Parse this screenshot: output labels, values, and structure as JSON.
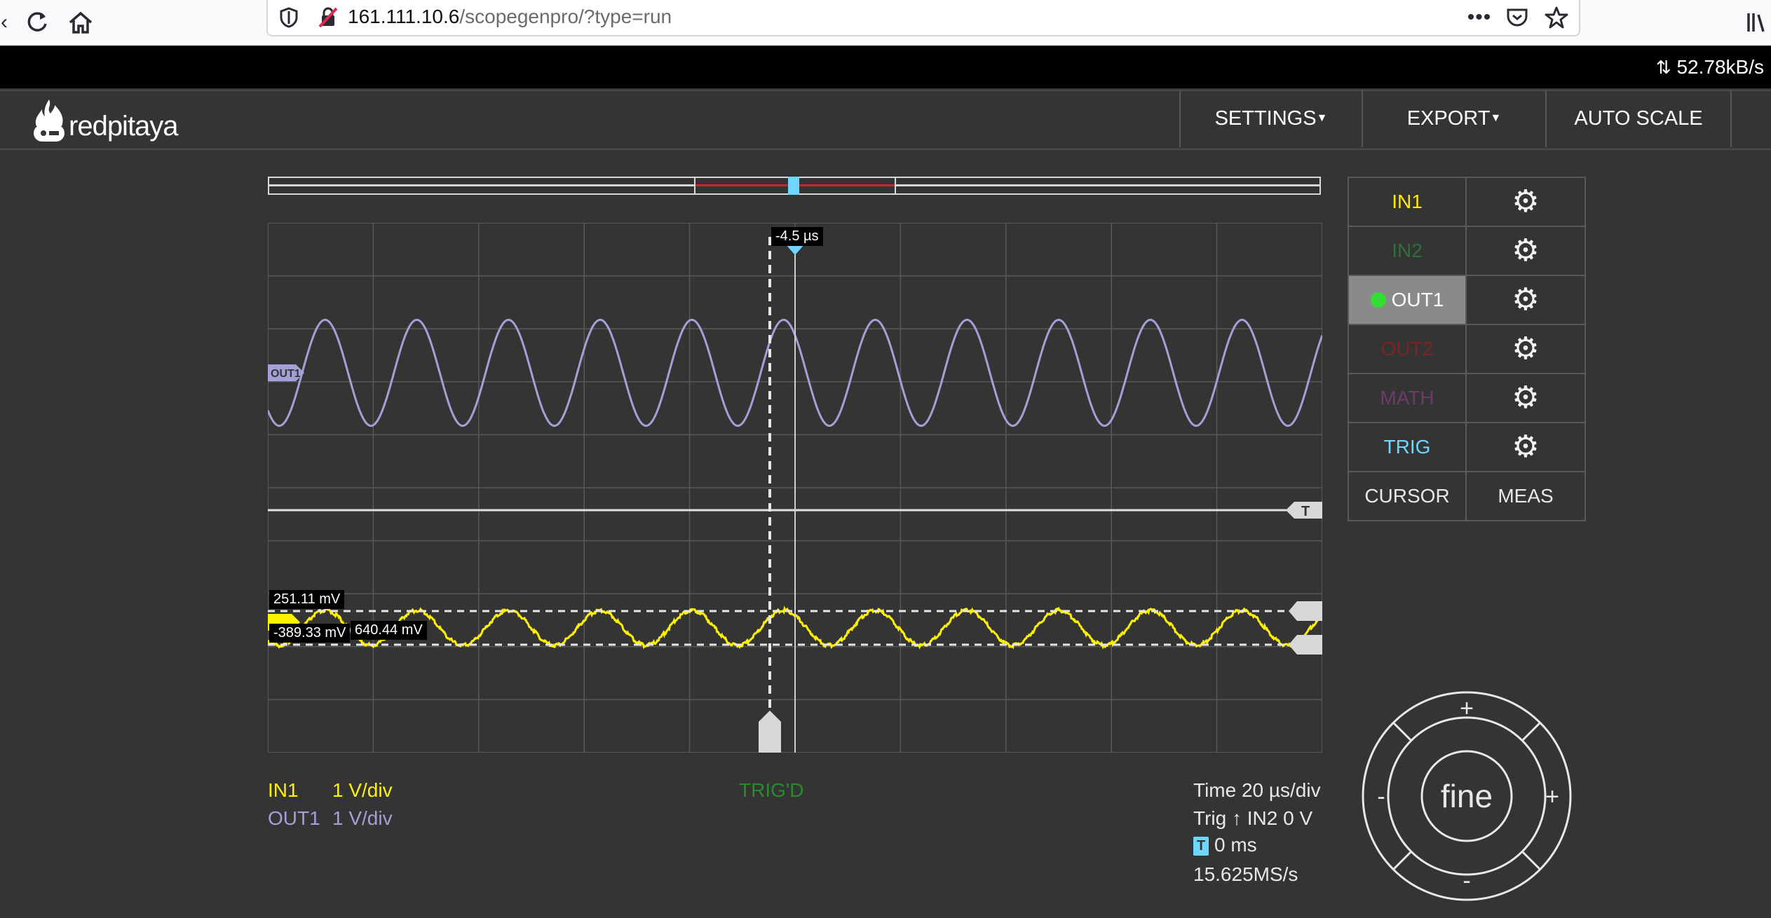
{
  "browser": {
    "url_host": "161.111.10.6",
    "url_path": "/scopegenpro/?type=run",
    "icons": [
      "reload-icon",
      "home-icon",
      "shield-icon",
      "insecure-lock-icon",
      "more-icon",
      "pocket-icon",
      "star-icon",
      "library-icon"
    ]
  },
  "status": {
    "net_speed": "52.78kB/s"
  },
  "app": {
    "logo_text": "redpitaya",
    "menu": {
      "settings": "SETTINGS",
      "export": "EXPORT",
      "autoscale": "AUTO SCALE"
    }
  },
  "scope": {
    "time_cursor": "-4.5 µs",
    "cursor_upper": "251.11 mV",
    "cursor_lower": "-389.33 mV",
    "cursor_delta": "640.44 mV",
    "out1_marker": "OUT1",
    "trig_marker": "T",
    "trig_state": "TRIG'D",
    "scales": [
      {
        "name": "IN1",
        "value": "1 V/div"
      },
      {
        "name": "OUT1",
        "value": "1 V/div"
      }
    ],
    "info": {
      "time": "Time 20 µs/div",
      "trig_prefix": "Trig",
      "trig_source": "IN2 0 V",
      "trig_arrow": "↑",
      "delay_badge": "T",
      "delay": "0 ms",
      "sample_rate": "15.625MS/s"
    },
    "out1_wave": {
      "cycles": 11.5,
      "amplitude_div": 1,
      "color": "#a3a0d8"
    },
    "in1_wave": {
      "cycles": 11.5,
      "amplitude_div": 0.33,
      "color": "#fff200"
    }
  },
  "channels": [
    {
      "label": "IN1",
      "color": "#ffeb00",
      "active": false
    },
    {
      "label": "IN2",
      "color": "#2f6f3c",
      "active": false
    },
    {
      "label": "OUT1",
      "color": "#ffffff",
      "active": true
    },
    {
      "label": "OUT2",
      "color": "#7a2424",
      "active": false
    },
    {
      "label": "MATH",
      "color": "#6b3b6e",
      "active": false
    },
    {
      "label": "TRIG",
      "color": "#6fd6ff",
      "active": false
    }
  ],
  "tools": {
    "cursor": "CURSOR",
    "meas": "MEAS"
  },
  "fine": {
    "label": "fine",
    "up": "+",
    "down": "-",
    "left": "-",
    "right": "+"
  },
  "colors": {
    "background": "#343434",
    "in1": "#fff200",
    "out1": "#a3a0d8",
    "trig": "#6fd6ff",
    "trigd": "#2b8a2b",
    "active_dot": "#33dd33"
  }
}
